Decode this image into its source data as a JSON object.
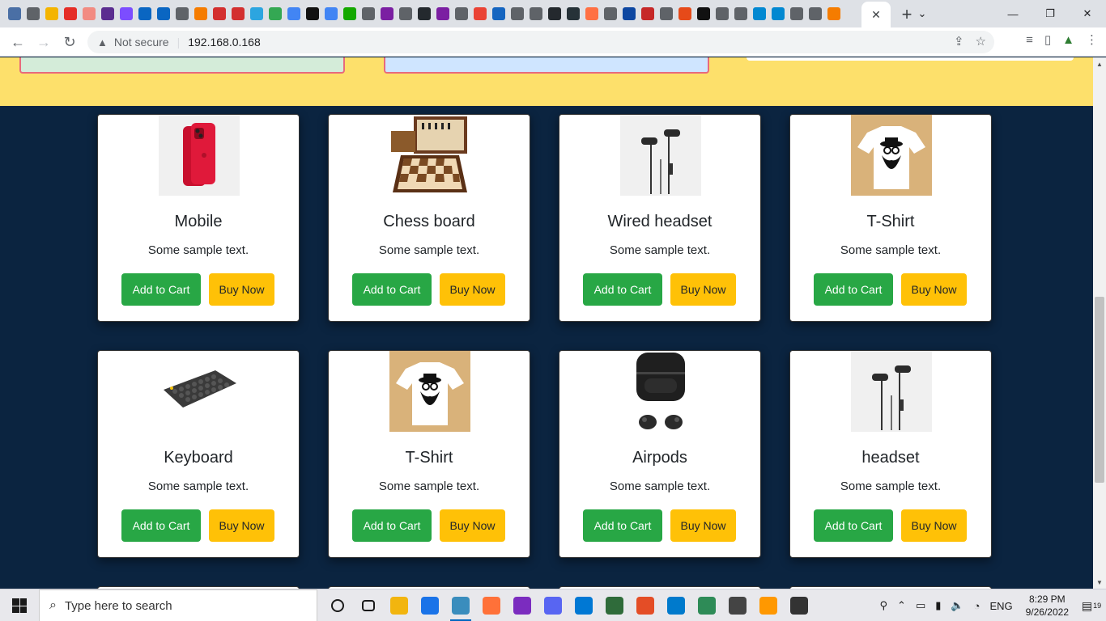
{
  "browser": {
    "address": "192.168.0.168",
    "security_label": "Not secure",
    "active_tab_close": "✕",
    "new_tab": "+",
    "tab_favicon_colors": [
      "#4a6fa5",
      "#5f6368",
      "#f4b400",
      "#e52d27",
      "#f28b82",
      "#5b2d90",
      "#7c4dff",
      "#0a66c2",
      "#0a66c2",
      "#5f6368",
      "#f57c00",
      "#d32f2f",
      "#d32f2f",
      "#2ca5e0",
      "#34a853",
      "#4285f4",
      "#111111",
      "#4285f4",
      "#14a800",
      "#5f6368",
      "#7b1fa2",
      "#5f6368",
      "#24292e",
      "#7b1fa2",
      "#5f6368",
      "#ea4335",
      "#1565c0",
      "#5f6368",
      "#5f6368",
      "#24292e",
      "#263238",
      "#ff7043",
      "#5f6368",
      "#0d47a1",
      "#c62828",
      "#5f6368",
      "#e64a19",
      "#111111",
      "#5f6368",
      "#5f6368",
      "#0288d1",
      "#0288d1",
      "#5f6368",
      "#5f6368",
      "#f57c00"
    ]
  },
  "products": [
    {
      "name": "Mobile",
      "text": "Some sample text.",
      "add_label": "Add to Cart",
      "buy_label": "Buy Now",
      "image": "iphone-red"
    },
    {
      "name": "Chess board",
      "text": "Some sample text.",
      "add_label": "Add to Cart",
      "buy_label": "Buy Now",
      "image": "chess-board"
    },
    {
      "name": "Wired headset",
      "text": "Some sample text.",
      "add_label": "Add to Cart",
      "buy_label": "Buy Now",
      "image": "earphones"
    },
    {
      "name": "T-Shirt",
      "text": "Some sample text.",
      "add_label": "Add to Cart",
      "buy_label": "Buy Now",
      "image": "tshirt"
    },
    {
      "name": "Keyboard",
      "text": "Some sample text.",
      "add_label": "Add to Cart",
      "buy_label": "Buy Now",
      "image": "keyboard"
    },
    {
      "name": "T-Shirt",
      "text": "Some sample text.",
      "add_label": "Add to Cart",
      "buy_label": "Buy Now",
      "image": "tshirt"
    },
    {
      "name": "Airpods",
      "text": "Some sample text.",
      "add_label": "Add to Cart",
      "buy_label": "Buy Now",
      "image": "earbuds"
    },
    {
      "name": "headset",
      "text": "Some sample text.",
      "add_label": "Add to Cart",
      "buy_label": "Buy Now",
      "image": "earphones"
    }
  ],
  "taskbar": {
    "search_placeholder": "Type here to search",
    "time": "8:29 PM",
    "date": "9/26/2022",
    "language": "ENG",
    "notification_count": "19",
    "app_colors": [
      "#1a1a1a",
      "#1a1a1a",
      "#f2b50f",
      "#1a73e8",
      "#3a8dbd",
      "#ff7139",
      "#7b2cbf",
      "#5865f2",
      "#0078d4",
      "#2f6b3a",
      "#e44d26",
      "#007acc",
      "#2e8b57",
      "#444444",
      "#ff9800",
      "#333333"
    ]
  },
  "colors": {
    "page_bg": "#0b2440",
    "banner": "#fde06b",
    "add_to_cart": "#28a745",
    "buy_now": "#ffc107"
  }
}
